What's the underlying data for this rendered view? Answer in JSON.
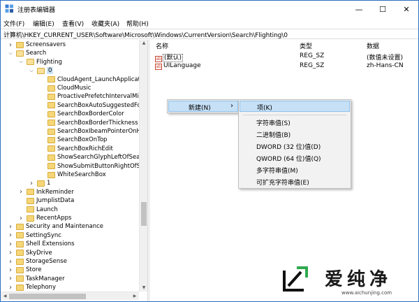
{
  "window": {
    "title": "注册表编辑器",
    "controls": {
      "minimize": "—",
      "maximize": "☐",
      "close": "✕"
    }
  },
  "menubar": {
    "items": [
      "文件(F)",
      "编辑(E)",
      "查看(V)",
      "收藏夹(A)",
      "帮助(H)"
    ]
  },
  "address": {
    "path": "计算机\\HKEY_CURRENT_USER\\Software\\Microsoft\\Windows\\CurrentVersion\\Search\\Flighting\\0"
  },
  "tree": {
    "items": [
      {
        "label": "Screensavers",
        "depth": 0,
        "expander": "collapsed"
      },
      {
        "label": "Search",
        "depth": 0,
        "expander": "expanded"
      },
      {
        "label": "Flighting",
        "depth": 1,
        "expander": "expanded"
      },
      {
        "label": "0",
        "depth": 2,
        "expander": "expanded",
        "selected": true
      },
      {
        "label": "CloudAgent_LaunchApplicationL",
        "depth": 3
      },
      {
        "label": "CloudMusic",
        "depth": 3
      },
      {
        "label": "ProactivePrefetchIntervalMinute",
        "depth": 3
      },
      {
        "label": "SearchBoxAutoSuggestedForeg",
        "depth": 3
      },
      {
        "label": "SearchBoxBorderColor",
        "depth": 3
      },
      {
        "label": "SearchBoxBorderThickness",
        "depth": 3
      },
      {
        "label": "SearchBoxIbeamPointerOnHove",
        "depth": 3
      },
      {
        "label": "SearchBoxOnTop",
        "depth": 3
      },
      {
        "label": "SearchBoxRichEdit",
        "depth": 3
      },
      {
        "label": "ShowSearchGlyphLeftOfSearch",
        "depth": 3
      },
      {
        "label": "ShowSubmitButtonRightOfSear",
        "depth": 3
      },
      {
        "label": "WhiteSearchBox",
        "depth": 3
      },
      {
        "label": "1",
        "depth": 2,
        "expander": "collapsed"
      },
      {
        "label": "InkReminder",
        "depth": 1,
        "expander": "collapsed"
      },
      {
        "label": "JumplistData",
        "depth": 1
      },
      {
        "label": "Launch",
        "depth": 1
      },
      {
        "label": "RecentApps",
        "depth": 1,
        "expander": "collapsed"
      },
      {
        "label": "Security and Maintenance",
        "depth": 0,
        "expander": "collapsed"
      },
      {
        "label": "SettingSync",
        "depth": 0,
        "expander": "collapsed"
      },
      {
        "label": "Shell Extensions",
        "depth": 0,
        "expander": "collapsed"
      },
      {
        "label": "SkyDrive",
        "depth": 0,
        "expander": "collapsed"
      },
      {
        "label": "StorageSense",
        "depth": 0,
        "expander": "collapsed"
      },
      {
        "label": "Store",
        "depth": 0,
        "expander": "collapsed"
      },
      {
        "label": "TaskManager",
        "depth": 0,
        "expander": "collapsed"
      },
      {
        "label": "Telephony",
        "depth": 0,
        "expander": "collapsed"
      }
    ]
  },
  "list": {
    "columns": {
      "name": "名称",
      "type": "类型",
      "data": "数据"
    },
    "rows": [
      {
        "icon": "ab",
        "name": "(默认)",
        "type": "REG_SZ",
        "data": "(数值未设置)"
      },
      {
        "icon": "ab",
        "name": "UILanguage",
        "type": "REG_SZ",
        "data": "zh-Hans-CN"
      }
    ]
  },
  "context_menu": {
    "new_label": "新建(N)",
    "arrow": "›"
  },
  "submenu": {
    "key_item": "项(K)",
    "items": [
      "字符串值(S)",
      "二进制值(B)",
      "DWORD (32 位)值(D)",
      "QWORD (64 位)值(Q)",
      "多字符串值(M)",
      "可扩充字符串值(E)"
    ]
  },
  "watermark": {
    "brand": "爱纯净",
    "url": "www.aichunjing.com"
  },
  "colors": {
    "selection": "#cce4f7",
    "menu_highlight": "#c6e0f6",
    "folder": "#f5d678",
    "window_border": "#2b6fbe"
  }
}
